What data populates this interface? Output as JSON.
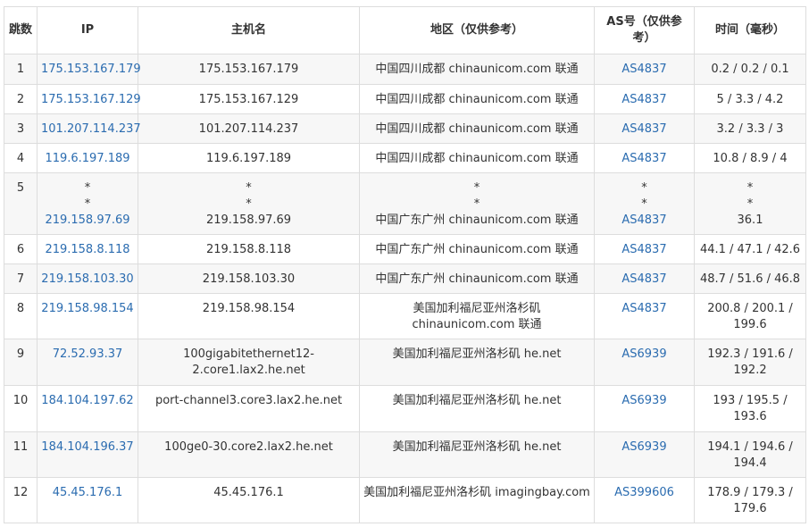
{
  "table": {
    "headers": [
      "跳数",
      "IP",
      "主机名",
      "地区（仅供参考）",
      "AS号（仅供参考）",
      "时间（毫秒）"
    ],
    "rows": [
      {
        "hop": "1",
        "ip": "175.153.167.179",
        "host": "175.153.167.179",
        "geo": "中国四川成都 chinaunicom.com 联通",
        "as": "AS4837",
        "time": "0.2 / 0.2 / 0.1"
      },
      {
        "hop": "2",
        "ip": "175.153.167.129",
        "host": "175.153.167.129",
        "geo": "中国四川成都 chinaunicom.com 联通",
        "as": "AS4837",
        "time": "5 / 3.3 / 4.2"
      },
      {
        "hop": "3",
        "ip": "101.207.114.237",
        "host": "101.207.114.237",
        "geo": "中国四川成都 chinaunicom.com 联通",
        "as": "AS4837",
        "time": "3.2 / 3.3 / 3"
      },
      {
        "hop": "4",
        "ip": "119.6.197.189",
        "host": "119.6.197.189",
        "geo": "中国四川成都 chinaunicom.com 联通",
        "as": "AS4837",
        "time": "10.8 / 8.9 / 4"
      },
      {
        "hop": "5",
        "ip_lines": [
          "*",
          "*",
          "219.158.97.69"
        ],
        "host_lines": [
          "*",
          "*",
          "219.158.97.69"
        ],
        "geo_lines": [
          "*",
          "*",
          "中国广东广州 chinaunicom.com 联通"
        ],
        "as_lines": [
          "*",
          "*",
          "AS4837"
        ],
        "time_lines": [
          "*",
          "*",
          "36.1"
        ]
      },
      {
        "hop": "6",
        "ip": "219.158.8.118",
        "host": "219.158.8.118",
        "geo": "中国广东广州 chinaunicom.com 联通",
        "as": "AS4837",
        "time": "44.1 / 47.1 / 42.6"
      },
      {
        "hop": "7",
        "ip": "219.158.103.30",
        "host": "219.158.103.30",
        "geo": "中国广东广州 chinaunicom.com 联通",
        "as": "AS4837",
        "time": "48.7 / 51.6 / 46.8"
      },
      {
        "hop": "8",
        "ip": "219.158.98.154",
        "host": "219.158.98.154",
        "geo": "美国加利福尼亚州洛杉矶 chinaunicom.com 联通",
        "as": "AS4837",
        "time": "200.8 / 200.1 / 199.6"
      },
      {
        "hop": "9",
        "ip": "72.52.93.37",
        "host": "100gigabitethernet12-2.core1.lax2.he.net",
        "geo": "美国加利福尼亚州洛杉矶 he.net",
        "as": "AS6939",
        "time": "192.3 / 191.6 / 192.2"
      },
      {
        "hop": "10",
        "ip": "184.104.197.62",
        "host": "port-channel3.core3.lax2.he.net",
        "geo": "美国加利福尼亚州洛杉矶 he.net",
        "as": "AS6939",
        "time": "193 / 195.5 / 193.6"
      },
      {
        "hop": "11",
        "ip": "184.104.196.37",
        "host": "100ge0-30.core2.lax2.he.net",
        "geo": "美国加利福尼亚州洛杉矶 he.net",
        "as": "AS6939",
        "time": "194.1 / 194.6 / 194.4"
      },
      {
        "hop": "12",
        "ip": "45.45.176.1",
        "host": "45.45.176.1",
        "geo": "美国加利福尼亚州洛杉矶 imagingbay.com",
        "as": "AS399606",
        "time": "178.9 / 179.3 / 179.6"
      }
    ]
  }
}
